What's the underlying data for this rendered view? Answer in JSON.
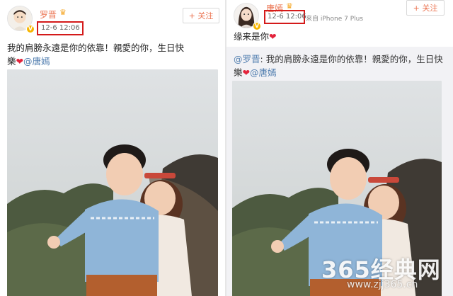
{
  "left_post": {
    "username": "罗晋",
    "timestamp": "12-6 12:06",
    "follow_label": "+ 关注",
    "body_line1": "我的肩膀永遠是你的依靠！親愛的你，生日快",
    "body_line2_prefix": "樂",
    "body_mention": "@唐嫣"
  },
  "right_post": {
    "username": "唐嫣",
    "timestamp": "12-6 12:06",
    "source": "来自 iPhone 7 Plus",
    "follow_label": "+ 关注",
    "body_text": "缘来是你",
    "repost_mention": "@罗晋",
    "repost_line1": ": 我的肩膀永遠是你的依靠！親愛的你，生日快",
    "repost_line2_prefix": "樂",
    "repost_mention2": "@唐嫣"
  },
  "watermark": {
    "main": "365经典网",
    "sub": "www.zjj365.cn"
  },
  "colors": {
    "accent": "#eb7350",
    "link": "#507daf",
    "highlight_box": "#d41a1a",
    "heart": "#e3233b"
  },
  "icons": {
    "verified": "verified-badge-icon",
    "crown": "vip-crown-icon",
    "heart": "heart-icon"
  }
}
